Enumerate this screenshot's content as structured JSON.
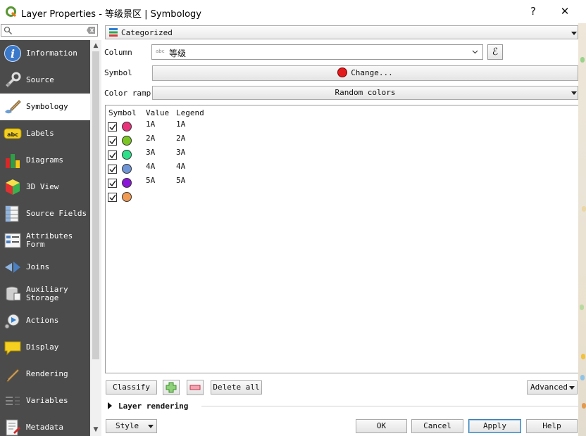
{
  "window": {
    "title": "Layer Properties - 等级景区 | Symbology",
    "help_label": "?",
    "close_label": "✕"
  },
  "sidebar": {
    "search_placeholder": "",
    "items": [
      {
        "label": "Information",
        "icon": "information-icon"
      },
      {
        "label": "Source",
        "icon": "source-icon"
      },
      {
        "label": "Symbology",
        "icon": "symbology-icon",
        "active": true
      },
      {
        "label": "Labels",
        "icon": "labels-icon"
      },
      {
        "label": "Diagrams",
        "icon": "diagrams-icon"
      },
      {
        "label": "3D View",
        "icon": "3d-view-icon"
      },
      {
        "label": "Source Fields",
        "icon": "source-fields-icon"
      },
      {
        "label": "Attributes Form",
        "icon": "attributes-form-icon"
      },
      {
        "label": "Joins",
        "icon": "joins-icon"
      },
      {
        "label": "Auxiliary Storage",
        "icon": "auxiliary-storage-icon"
      },
      {
        "label": "Actions",
        "icon": "actions-icon"
      },
      {
        "label": "Display",
        "icon": "display-icon"
      },
      {
        "label": "Rendering",
        "icon": "rendering-icon"
      },
      {
        "label": "Variables",
        "icon": "variables-icon"
      },
      {
        "label": "Metadata",
        "icon": "metadata-icon"
      }
    ]
  },
  "symbology": {
    "renderer": "Categorized",
    "column_label": "Column",
    "column_type_badge": "abc",
    "column_value": "等级",
    "symbol_label": "Symbol",
    "symbol_button": "Change...",
    "symbol_color": "#e31a1c",
    "color_ramp_label": "Color ramp",
    "color_ramp_value": "Random colors",
    "headers": {
      "symbol": "Symbol",
      "value": "Value",
      "legend": "Legend"
    },
    "categories": [
      {
        "value": "1A",
        "legend": "1A",
        "color": "#e8327a",
        "checked": true
      },
      {
        "value": "2A",
        "legend": "2A",
        "color": "#7ac523",
        "checked": true
      },
      {
        "value": "3A",
        "legend": "3A",
        "color": "#2be089",
        "checked": true
      },
      {
        "value": "4A",
        "legend": "4A",
        "color": "#6f95d6",
        "checked": true
      },
      {
        "value": "5A",
        "legend": "5A",
        "color": "#8b16d9",
        "checked": true
      },
      {
        "value": "",
        "legend": "",
        "color": "#f09a52",
        "checked": true
      }
    ],
    "classify_button": "Classify",
    "delete_all_button": "Delete all",
    "advanced_button": "Advanced",
    "layer_rendering": "Layer rendering"
  },
  "footer": {
    "style_button": "Style",
    "ok_button": "OK",
    "cancel_button": "Cancel",
    "apply_button": "Apply",
    "help_button": "Help"
  }
}
